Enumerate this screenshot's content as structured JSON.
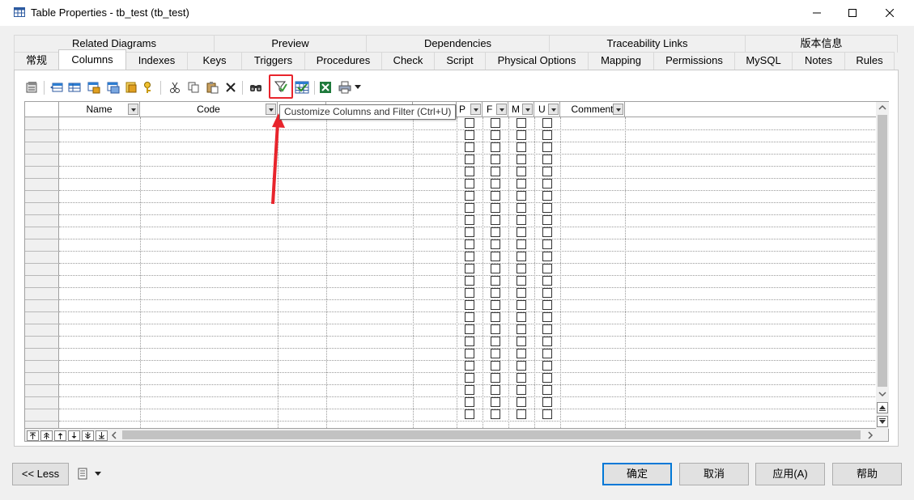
{
  "window": {
    "title": "Table Properties - tb_test (tb_test)"
  },
  "tabs_back": [
    "Related Diagrams",
    "Preview",
    "Dependencies",
    "Traceability Links",
    "版本信息"
  ],
  "tabs_front": [
    "常规",
    "Columns",
    "Indexes",
    "Keys",
    "Triggers",
    "Procedures",
    "Check",
    "Script",
    "Physical Options",
    "Mapping",
    "Permissions",
    "MySQL",
    "Notes",
    "Rules"
  ],
  "active_tab": "Columns",
  "toolbar": {
    "icons": [
      "properties-icon",
      "insert-row-icon",
      "add-row-icon",
      "add-columns-icon",
      "reuse-columns-icon",
      "new-key-icon",
      "cut-icon",
      "copy-icon",
      "paste-icon",
      "delete-icon",
      "find-icon",
      "customize-columns-filter-icon",
      "auto-filter-icon",
      "excel-export-icon",
      "print-icon"
    ],
    "highlighted_icon": "customize-columns-filter-icon"
  },
  "tooltip": {
    "text": "Customize Columns and Filter (Ctrl+U)"
  },
  "grid": {
    "columns": [
      {
        "label": "Name"
      },
      {
        "label": "Code"
      },
      {
        "label": ""
      },
      {
        "label": ""
      },
      {
        "label": ""
      },
      {
        "label": "P"
      },
      {
        "label": "F"
      },
      {
        "label": "M"
      },
      {
        "label": "U"
      },
      {
        "label": "Comment"
      }
    ],
    "rows": 25
  },
  "buttons": {
    "less": "<< Less",
    "ok": "确定",
    "cancel": "取消",
    "apply": "应用(A)",
    "help": "帮助"
  },
  "colors": {
    "highlight": "#e8242c",
    "primary_border": "#0078d7"
  }
}
